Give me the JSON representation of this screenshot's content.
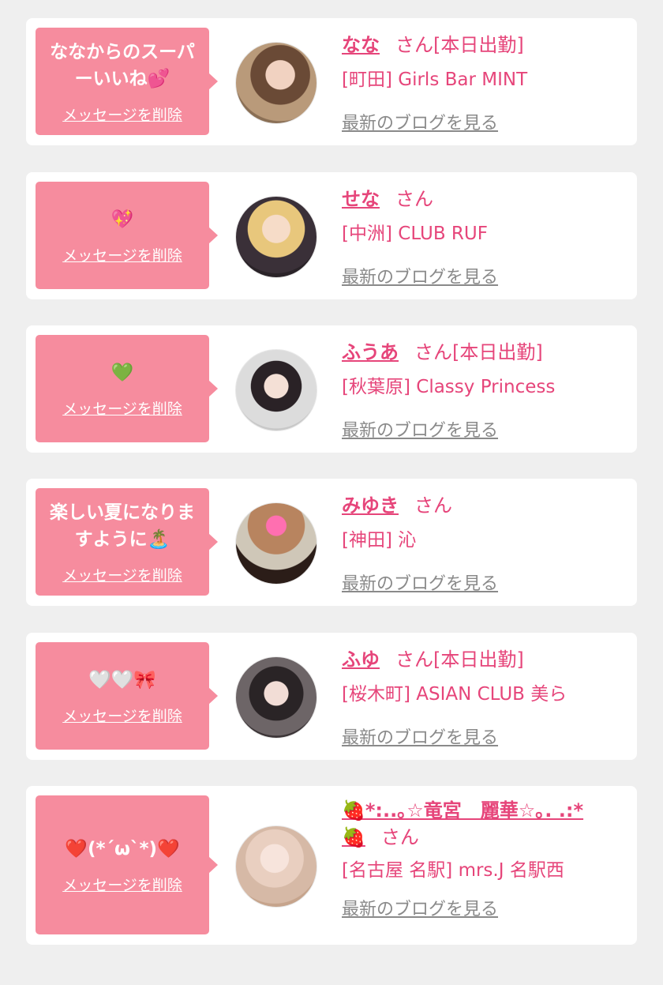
{
  "cards": [
    {
      "message": "ななからのスーパーいいね💕",
      "delete_label": "メッセージを削除",
      "name": "なな",
      "honorific": "さん[本日出勤]",
      "shop": "[町田] Girls Bar MINT",
      "blog_link": "最新のブログを見る"
    },
    {
      "message": "💖",
      "delete_label": "メッセージを削除",
      "name": "せな",
      "honorific": "さん",
      "shop": "[中洲] CLUB RUF",
      "blog_link": "最新のブログを見る"
    },
    {
      "message": "💚",
      "delete_label": "メッセージを削除",
      "name": "ふうあ",
      "honorific": "さん[本日出勤]",
      "shop": "[秋葉原] Classy Princess",
      "blog_link": "最新のブログを見る"
    },
    {
      "message": "楽しい夏になりますように🏝️",
      "delete_label": "メッセージを削除",
      "name": "みゆき",
      "honorific": "さん",
      "shop": "[神田] 沁",
      "blog_link": "最新のブログを見る"
    },
    {
      "message": "🤍🤍🎀",
      "delete_label": "メッセージを削除",
      "name": "ふゆ",
      "honorific": "さん[本日出勤]",
      "shop": "[桜木町] ASIAN CLUB 美ら",
      "blog_link": "最新のブログを見る"
    },
    {
      "message": "❤️(*´ω`*)❤️",
      "delete_label": "メッセージを削除",
      "name": "🍓*:..｡☆竜宮　麗華☆｡. .:*🍓",
      "honorific": "さん",
      "shop": "[名古屋 名駅] mrs.J 名駅西",
      "blog_link": "最新のブログを見る"
    }
  ],
  "colors": {
    "accent": "#e6457a",
    "bubble": "#f68c9e",
    "link_gray": "#8a8a8a",
    "background": "#efefef"
  }
}
